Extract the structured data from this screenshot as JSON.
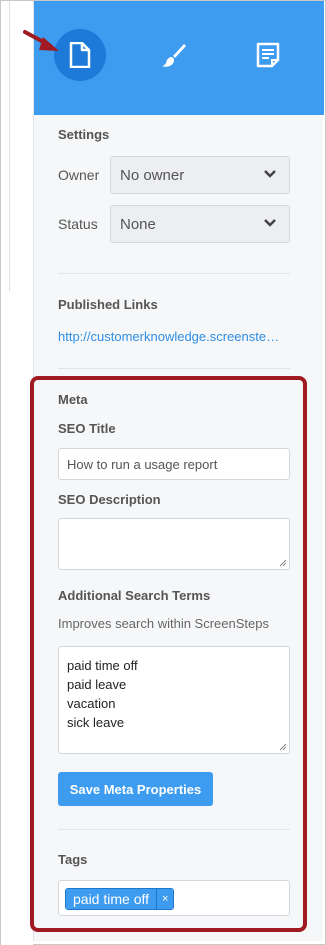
{
  "colors": {
    "accent": "#3d9bf0",
    "active_tab": "#1e7ad8",
    "highlight": "#a01a22",
    "link": "#2f8de4"
  },
  "tabs": [
    {
      "icon": "document-icon",
      "active": true
    },
    {
      "icon": "brush-icon",
      "active": false
    },
    {
      "icon": "notes-icon",
      "active": false
    }
  ],
  "settings": {
    "title": "Settings",
    "owner_label": "Owner",
    "owner_value": "No owner",
    "status_label": "Status",
    "status_value": "None"
  },
  "published": {
    "title": "Published Links",
    "link": "http://customerknowledge.screenste…"
  },
  "meta": {
    "title": "Meta",
    "seo_title_label": "SEO Title",
    "seo_title_value": "How to run a usage report",
    "seo_description_label": "SEO Description",
    "seo_description_value": "",
    "search_terms_label": "Additional Search Terms",
    "search_terms_hint": "Improves search within ScreenSteps",
    "search_terms": [
      "paid time off",
      "paid leave",
      "vacation",
      "sick leave"
    ],
    "save_button": "Save Meta Properties"
  },
  "tags": {
    "title": "Tags",
    "items": [
      {
        "label": "paid time off",
        "remove": "×"
      }
    ]
  }
}
